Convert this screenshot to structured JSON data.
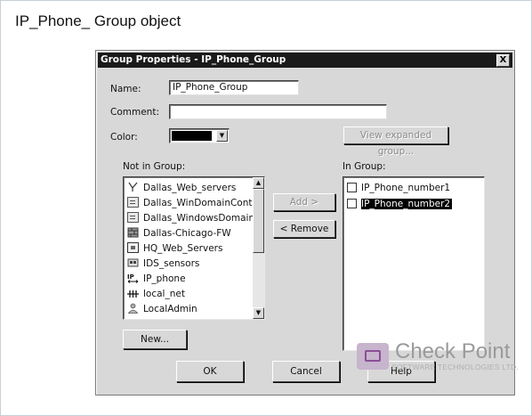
{
  "caption": "IP_Phone_ Group object",
  "dialog": {
    "title": "Group Properties - IP_Phone_Group",
    "close_glyph": "X",
    "name_label": "Name:",
    "name_value": "IP_Phone_Group",
    "comment_label": "Comment:",
    "comment_value": "",
    "color_label": "Color:",
    "color_value": "#000000",
    "view_expanded_label": "View expanded group...",
    "not_in_group_label": "Not in Group:",
    "in_group_label": "In Group:",
    "add_label": "Add  >",
    "remove_label": "<  Remove",
    "new_label": "New...",
    "ok_label": "OK",
    "cancel_label": "Cancel",
    "help_label": "Help",
    "not_in_group_items": [
      {
        "label": "Dallas_Web_servers",
        "icon": "network-group-icon"
      },
      {
        "label": "Dallas_WinDomainControl",
        "icon": "server-icon"
      },
      {
        "label": "Dallas_WindowsDomainC",
        "icon": "server-icon"
      },
      {
        "label": "Dallas-Chicago-FW",
        "icon": "firewall-icon"
      },
      {
        "label": "HQ_Web_Servers",
        "icon": "server-icon"
      },
      {
        "label": "IDS_sensors",
        "icon": "group-icon"
      },
      {
        "label": "IP_phone",
        "icon": "ip-range-icon"
      },
      {
        "label": "local_net",
        "icon": "network-icon"
      },
      {
        "label": "LocalAdmin",
        "icon": "user-icon"
      }
    ],
    "in_group_items": [
      {
        "label": "IP_Phone_number1",
        "selected": false
      },
      {
        "label": "IP_Phone_number2",
        "selected": true
      }
    ]
  },
  "branding": {
    "name": "Check Point",
    "tagline": "SOFTWARE TECHNOLOGIES LTD."
  }
}
